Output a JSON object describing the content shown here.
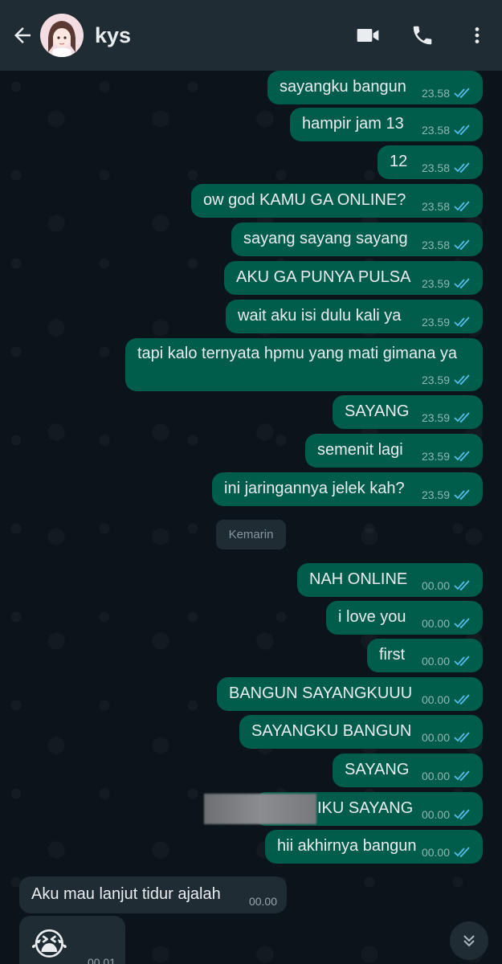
{
  "header": {
    "contact_name": "kys",
    "icons": {
      "back": "back-arrow-icon",
      "video": "video-call-icon",
      "call": "phone-icon",
      "menu": "more-vert-icon"
    }
  },
  "messages": [
    {
      "text": "sayangku bangun",
      "time": "23.58",
      "status": "read"
    },
    {
      "text": "hampir jam 13",
      "time": "23.58",
      "status": "read"
    },
    {
      "text": "12",
      "time": "23.58",
      "status": "read"
    },
    {
      "text": "ow god KAMU GA ONLINE?",
      "time": "23.58",
      "status": "read"
    },
    {
      "text": "sayang sayang sayang",
      "time": "23.58",
      "status": "read"
    },
    {
      "text": "AKU GA PUNYA PULSA",
      "time": "23.59",
      "status": "read"
    },
    {
      "text": "wait aku isi dulu kali ya",
      "time": "23.59",
      "status": "read"
    },
    {
      "text": "tapi kalo ternyata hpmu yang mati gimana ya",
      "time": "23.59",
      "status": "read"
    },
    {
      "text": "SAYANG",
      "time": "23.59",
      "status": "read"
    },
    {
      "text": "semenit lagi",
      "time": "23.59",
      "status": "read"
    },
    {
      "text": "ini jaringannya jelek kah?",
      "time": "23.59",
      "status": "read"
    },
    {
      "text": "NAH ONLINE",
      "time": "00.00",
      "status": "read"
    },
    {
      "text": "i love you",
      "time": "00.00",
      "status": "read"
    },
    {
      "text": "first",
      "time": "00.00",
      "status": "read"
    },
    {
      "text": "BANGUN SAYANGKUUU",
      "time": "00.00",
      "status": "read"
    },
    {
      "text": "SAYANGKU BANGUN",
      "time": "00.00",
      "status": "read"
    },
    {
      "text": "SAYANG",
      "time": "00.00",
      "status": "read"
    },
    {
      "text": "IKU SAYANG",
      "time": "00.00",
      "status": "read"
    },
    {
      "text": "hii akhirnya bangun",
      "time": "00.00",
      "status": "read"
    }
  ],
  "date_separator": "Kemarin",
  "incoming": [
    {
      "text": "Aku mau lanjut tidur ajalah",
      "time": "00.00"
    },
    {
      "emoji": "😭",
      "time": "00.01"
    }
  ],
  "colors": {
    "outgoing_bubble": "#005c4b",
    "incoming_bubble": "#1f2c34",
    "read_ticks": "#53bdeb"
  }
}
